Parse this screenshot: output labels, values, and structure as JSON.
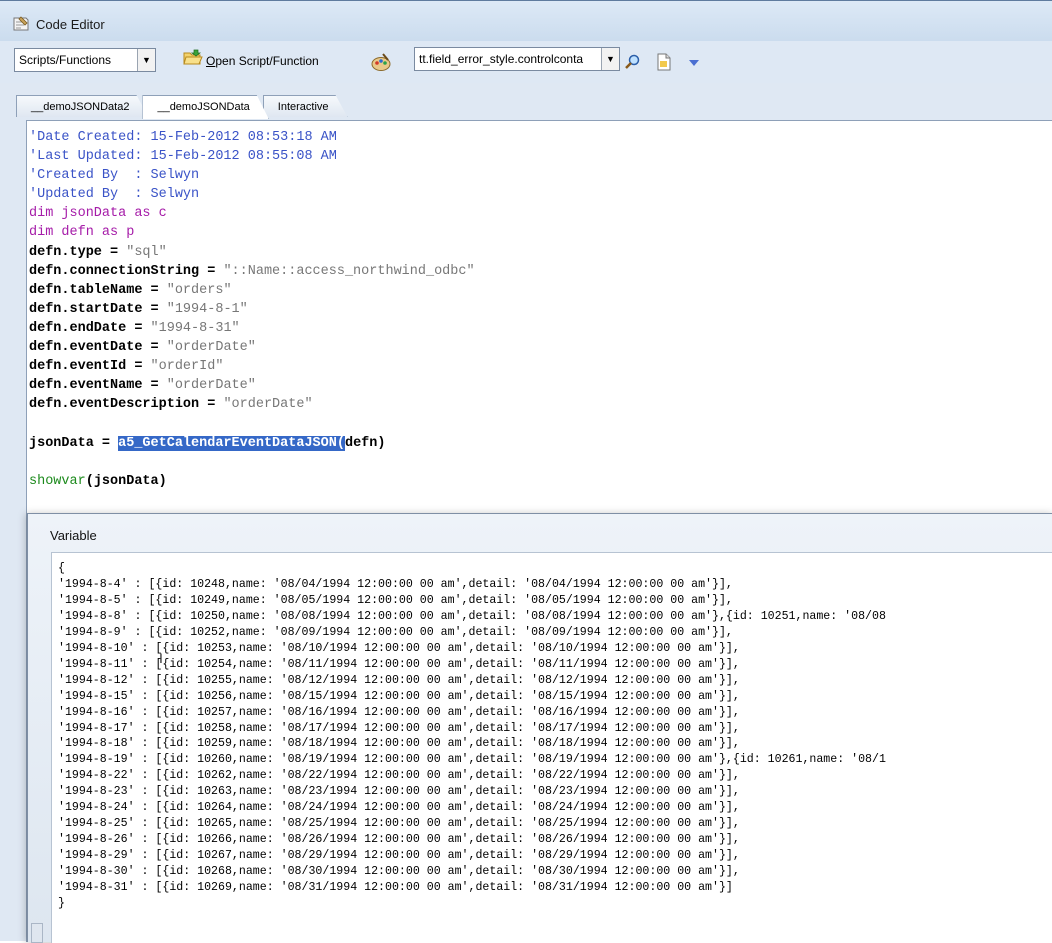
{
  "window": {
    "title": "Code Editor",
    "icon": "code-editor-icon"
  },
  "toolbar": {
    "scripts_combo": "Scripts/Functions",
    "open_label_underlined": "O",
    "open_label_rest": "pen Script/Function",
    "field_combo": "tt.field_error_style.controlconta",
    "icons": [
      "open-folder-icon",
      "palette-icon",
      "search-icon",
      "document-icon",
      "dropdown-icon"
    ]
  },
  "tabs": [
    {
      "label": "__demoJSONData2",
      "active": false
    },
    {
      "label": "__demoJSONData",
      "active": true
    },
    {
      "label": "Interactive",
      "active": false
    }
  ],
  "editor": {
    "lines": [
      {
        "type": "comment",
        "text": "'Date Created: 15-Feb-2012 08:53:18 AM"
      },
      {
        "type": "comment",
        "text": "'Last Updated: 15-Feb-2012 08:55:08 AM"
      },
      {
        "type": "comment",
        "text": "'Created By  : Selwyn"
      },
      {
        "type": "comment",
        "text": "'Updated By  : Selwyn"
      },
      {
        "type": "keyword",
        "text": "dim jsonData as c"
      },
      {
        "type": "keyword",
        "text": "dim defn as p"
      },
      {
        "type": "assign",
        "lhs": "defn.type = ",
        "rhs": "\"sql\""
      },
      {
        "type": "assign",
        "lhs": "defn.connectionString = ",
        "rhs": "\"::Name::access_northwind_odbc\""
      },
      {
        "type": "assign",
        "lhs": "defn.tableName = ",
        "rhs": "\"orders\""
      },
      {
        "type": "assign",
        "lhs": "defn.startDate = ",
        "rhs": "\"1994-8-1\""
      },
      {
        "type": "assign",
        "lhs": "defn.endDate = ",
        "rhs": "\"1994-8-31\""
      },
      {
        "type": "assign",
        "lhs": "defn.eventDate = ",
        "rhs": "\"orderDate\""
      },
      {
        "type": "assign",
        "lhs": "defn.eventId = ",
        "rhs": "\"orderId\""
      },
      {
        "type": "assign",
        "lhs": "defn.eventName = ",
        "rhs": "\"orderDate\""
      },
      {
        "type": "assign",
        "lhs": "defn.eventDescription = ",
        "rhs": "\"orderDate\""
      },
      {
        "type": "blank",
        "text": ""
      },
      {
        "type": "call",
        "lhs": "jsonData = ",
        "fn": "a5_GetCalendarEventDataJSON",
        "sel": "(",
        "rest": "defn)"
      },
      {
        "type": "blank",
        "text": ""
      },
      {
        "type": "showvar",
        "fn": "showvar",
        "rest": "(jsonData)"
      }
    ]
  },
  "dialog": {
    "title": "Variable",
    "lines": [
      "{",
      "'1994-8-4' : [{id: 10248,name: '08/04/1994 12:00:00 00 am',detail: '08/04/1994 12:00:00 00 am'}],",
      "'1994-8-5' : [{id: 10249,name: '08/05/1994 12:00:00 00 am',detail: '08/05/1994 12:00:00 00 am'}],",
      "'1994-8-8' : [{id: 10250,name: '08/08/1994 12:00:00 00 am',detail: '08/08/1994 12:00:00 00 am'},{id: 10251,name: '08/08",
      "'1994-8-9' : [{id: 10252,name: '08/09/1994 12:00:00 00 am',detail: '08/09/1994 12:00:00 00 am'}],",
      "'1994-8-10' : [{id: 10253,name: '08/10/1994 12:00:00 00 am',detail: '08/10/1994 12:00:00 00 am'}],",
      "'1994-8-11' : [{id: 10254,name: '08/11/1994 12:00:00 00 am',detail: '08/11/1994 12:00:00 00 am'}],",
      "'1994-8-12' : [{id: 10255,name: '08/12/1994 12:00:00 00 am',detail: '08/12/1994 12:00:00 00 am'}],",
      "'1994-8-15' : [{id: 10256,name: '08/15/1994 12:00:00 00 am',detail: '08/15/1994 12:00:00 00 am'}],",
      "'1994-8-16' : [{id: 10257,name: '08/16/1994 12:00:00 00 am',detail: '08/16/1994 12:00:00 00 am'}],",
      "'1994-8-17' : [{id: 10258,name: '08/17/1994 12:00:00 00 am',detail: '08/17/1994 12:00:00 00 am'}],",
      "'1994-8-18' : [{id: 10259,name: '08/18/1994 12:00:00 00 am',detail: '08/18/1994 12:00:00 00 am'}],",
      "'1994-8-19' : [{id: 10260,name: '08/19/1994 12:00:00 00 am',detail: '08/19/1994 12:00:00 00 am'},{id: 10261,name: '08/1",
      "'1994-8-22' : [{id: 10262,name: '08/22/1994 12:00:00 00 am',detail: '08/22/1994 12:00:00 00 am'}],",
      "'1994-8-23' : [{id: 10263,name: '08/23/1994 12:00:00 00 am',detail: '08/23/1994 12:00:00 00 am'}],",
      "'1994-8-24' : [{id: 10264,name: '08/24/1994 12:00:00 00 am',detail: '08/24/1994 12:00:00 00 am'}],",
      "'1994-8-25' : [{id: 10265,name: '08/25/1994 12:00:00 00 am',detail: '08/25/1994 12:00:00 00 am'}],",
      "'1994-8-26' : [{id: 10266,name: '08/26/1994 12:00:00 00 am',detail: '08/26/1994 12:00:00 00 am'}],",
      "'1994-8-29' : [{id: 10267,name: '08/29/1994 12:00:00 00 am',detail: '08/29/1994 12:00:00 00 am'}],",
      "'1994-8-30' : [{id: 10268,name: '08/30/1994 12:00:00 00 am',detail: '08/30/1994 12:00:00 00 am'}],",
      "'1994-8-31' : [{id: 10269,name: '08/31/1994 12:00:00 00 am',detail: '08/31/1994 12:00:00 00 am'}]",
      "}"
    ]
  }
}
